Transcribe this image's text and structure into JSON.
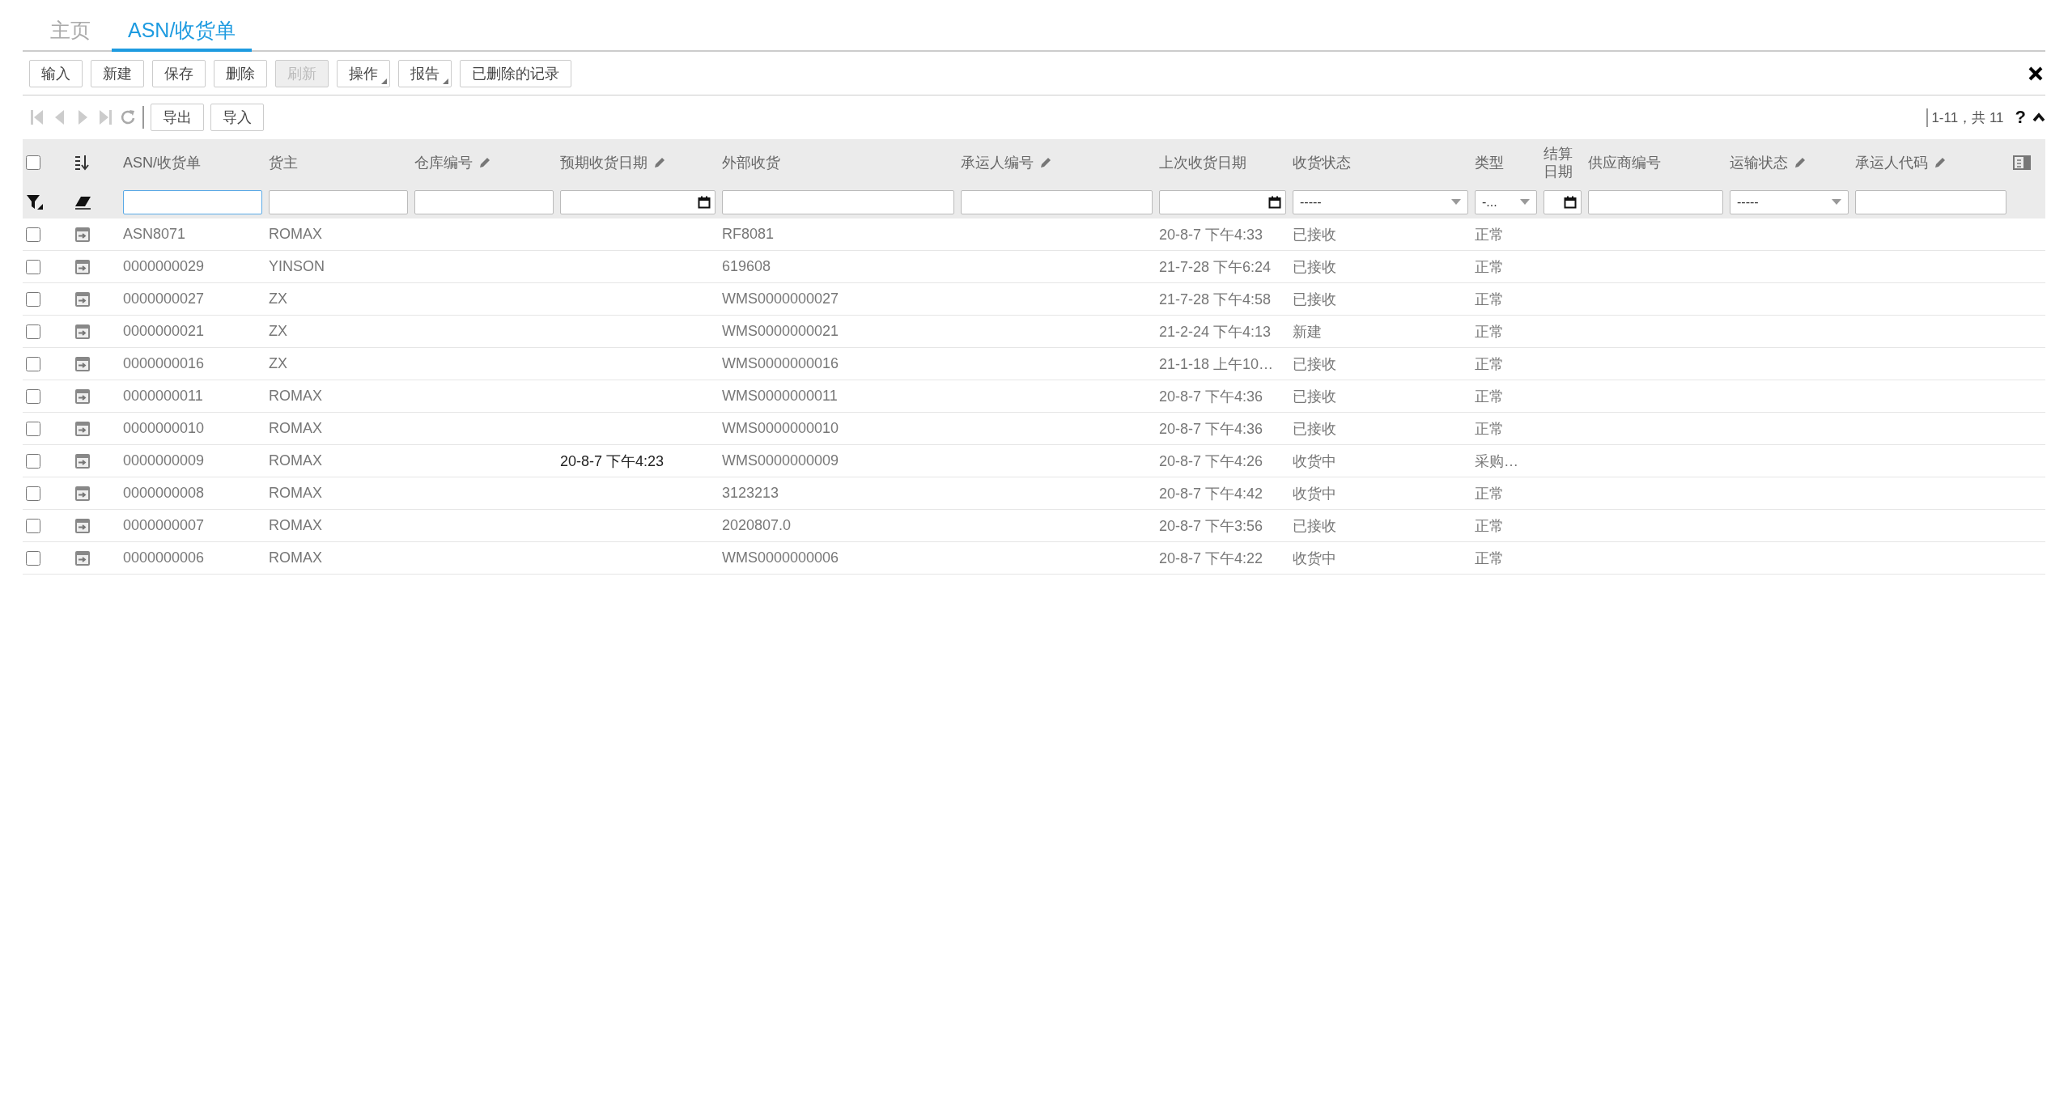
{
  "tabs": [
    {
      "label": "主页",
      "selected": false
    },
    {
      "label": "ASN/收货单",
      "selected": true
    }
  ],
  "toolbar": [
    {
      "label": "输入",
      "disabled": false,
      "menu": false
    },
    {
      "label": "新建",
      "disabled": false,
      "menu": false
    },
    {
      "label": "保存",
      "disabled": false,
      "menu": false
    },
    {
      "label": "删除",
      "disabled": false,
      "menu": false
    },
    {
      "label": "刷新",
      "disabled": true,
      "menu": false
    },
    {
      "label": "操作",
      "disabled": false,
      "menu": true
    },
    {
      "label": "报告",
      "disabled": false,
      "menu": true
    },
    {
      "label": "已删除的记录",
      "disabled": false,
      "menu": false
    }
  ],
  "navigator": {
    "buttons": [
      "导出",
      "导入"
    ],
    "pager": "1-11，共 11",
    "help": "?"
  },
  "table": {
    "select_all": {
      "checked": false
    },
    "columns": [
      {
        "kind": "text",
        "label": "ASN/收货单",
        "editable": false
      },
      {
        "kind": "text",
        "label": "货主",
        "editable": false
      },
      {
        "kind": "text",
        "label": "仓库编号",
        "editable": true
      },
      {
        "kind": "date",
        "label": "预期收货日期",
        "editable": true
      },
      {
        "kind": "text",
        "label": "外部收货",
        "editable": false
      },
      {
        "kind": "text",
        "label": "承运人编号",
        "editable": true
      },
      {
        "kind": "date",
        "label": "上次收货日期",
        "editable": false
      },
      {
        "kind": "select",
        "label": "收货状态",
        "editable": false,
        "filter_value": "-----"
      },
      {
        "kind": "select",
        "label": "类型",
        "editable": false,
        "filter_value": "-..."
      },
      {
        "kind": "date",
        "label": "结算日期",
        "editable": false
      },
      {
        "kind": "text",
        "label": "供应商编号",
        "editable": false
      },
      {
        "kind": "select",
        "label": "运输状态",
        "editable": true,
        "filter_value": "-----"
      },
      {
        "kind": "text",
        "label": "承运人代码",
        "editable": true
      }
    ],
    "rows": [
      {
        "checked": false,
        "asn": "ASN8071",
        "owner": "ROMAX",
        "external": "RF8081",
        "last_date": "20-8-7 下午4:33",
        "status": "已接收",
        "type": "正常"
      },
      {
        "checked": false,
        "asn": "0000000029",
        "owner": "YINSON",
        "external": "619608",
        "last_date": "21-7-28 下午6:24",
        "status": "已接收",
        "type": "正常"
      },
      {
        "checked": false,
        "asn": "0000000027",
        "owner": "ZX",
        "external": "WMS0000000027",
        "last_date": "21-7-28 下午4:58",
        "status": "已接收",
        "type": "正常"
      },
      {
        "checked": false,
        "asn": "0000000021",
        "owner": "ZX",
        "external": "WMS0000000021",
        "last_date": "21-2-24 下午4:13",
        "status": "新建",
        "type": "正常"
      },
      {
        "checked": false,
        "asn": "0000000016",
        "owner": "ZX",
        "external": "WMS0000000016",
        "last_date": "21-1-18 上午10…",
        "status": "已接收",
        "type": "正常"
      },
      {
        "checked": false,
        "asn": "0000000011",
        "owner": "ROMAX",
        "external": "WMS0000000011",
        "last_date": "20-8-7 下午4:36",
        "status": "已接收",
        "type": "正常"
      },
      {
        "checked": false,
        "asn": "0000000010",
        "owner": "ROMAX",
        "external": "WMS0000000010",
        "last_date": "20-8-7 下午4:36",
        "status": "已接收",
        "type": "正常"
      },
      {
        "checked": false,
        "asn": "0000000009",
        "owner": "ROMAX",
        "expected": "20-8-7 下午4:23",
        "external": "WMS0000000009",
        "last_date": "20-8-7 下午4:26",
        "status": "收货中",
        "type": "采购…"
      },
      {
        "checked": false,
        "asn": "0000000008",
        "owner": "ROMAX",
        "external": "3123213",
        "last_date": "20-8-7 下午4:42",
        "status": "收货中",
        "type": "正常"
      },
      {
        "checked": false,
        "asn": "0000000007",
        "owner": "ROMAX",
        "external": "2020807.0",
        "last_date": "20-8-7 下午3:56",
        "status": "已接收",
        "type": "正常"
      },
      {
        "checked": false,
        "asn": "0000000006",
        "owner": "ROMAX",
        "external": "WMS0000000006",
        "last_date": "20-8-7 下午4:22",
        "status": "收货中",
        "type": "正常"
      }
    ]
  }
}
